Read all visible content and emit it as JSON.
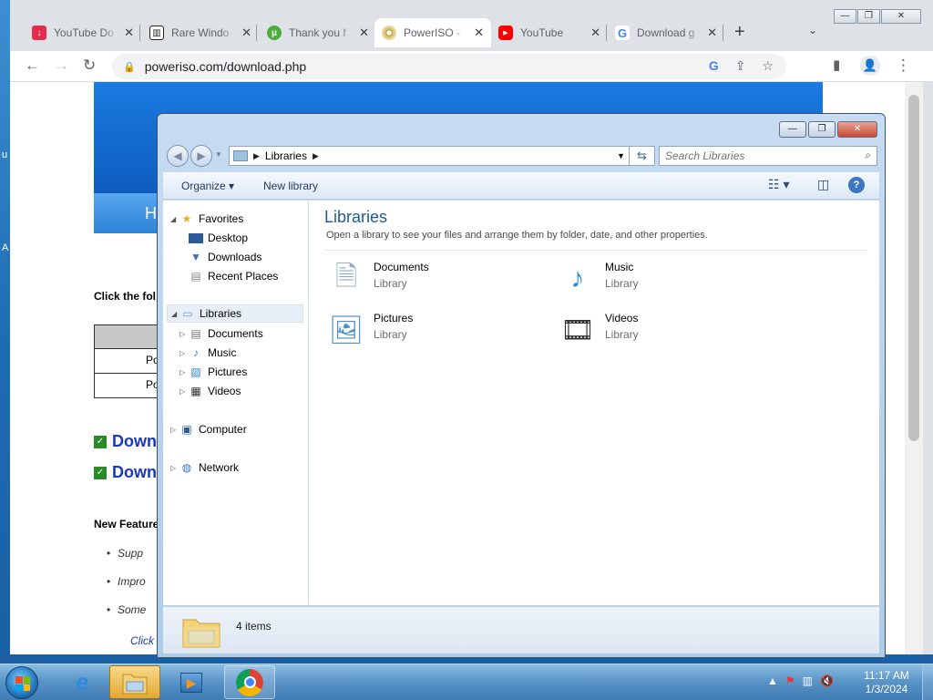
{
  "desktop": {
    "frag_u": "u",
    "frag_a": "A"
  },
  "chrome": {
    "tabs": [
      {
        "title": "YouTube Do",
        "favicon": "download-icon",
        "color": "#e32d4e"
      },
      {
        "title": "Rare Windo",
        "favicon": "building-icon",
        "color": "#222222"
      },
      {
        "title": "Thank you f",
        "favicon": "utorrent-icon",
        "color": "#4cae3a"
      },
      {
        "title": "PowerISO -",
        "favicon": "disc-icon",
        "color": "#c8a54a",
        "active": true
      },
      {
        "title": "YouTube",
        "favicon": "youtube-icon",
        "color": "#ff0000"
      },
      {
        "title": "Download g",
        "favicon": "google-icon",
        "color": "#4285f4"
      }
    ],
    "url": "poweriso.com/download.php",
    "page": {
      "nav_letter": "H",
      "click_text": "Click the fol",
      "table_rows": [
        "Po",
        "Po"
      ],
      "downloads": [
        "Down",
        "Down"
      ],
      "new_features": "New Feature",
      "bullets": [
        "Supp",
        "Impro",
        "Some"
      ],
      "click_link": "Click"
    }
  },
  "explorer": {
    "address": "Libraries",
    "search_placeholder": "Search Libraries",
    "toolbar": {
      "organize": "Organize",
      "new_library": "New library"
    },
    "nav": {
      "favorites": "Favorites",
      "desktop": "Desktop",
      "downloads": "Downloads",
      "recent": "Recent Places",
      "libraries": "Libraries",
      "documents": "Documents",
      "music": "Music",
      "pictures": "Pictures",
      "videos": "Videos",
      "computer": "Computer",
      "network": "Network"
    },
    "content": {
      "title": "Libraries",
      "description": "Open a library to see your files and arrange them by folder, date, and other properties.",
      "libraries": [
        {
          "name": "Documents",
          "type": "Library",
          "icon": "documents-library-icon"
        },
        {
          "name": "Music",
          "type": "Library",
          "icon": "music-library-icon"
        },
        {
          "name": "Pictures",
          "type": "Library",
          "icon": "pictures-library-icon"
        },
        {
          "name": "Videos",
          "type": "Library",
          "icon": "videos-library-icon"
        }
      ]
    },
    "status": "4 items"
  },
  "taskbar": {
    "time": "11:17 AM",
    "date": "1/3/2024"
  }
}
